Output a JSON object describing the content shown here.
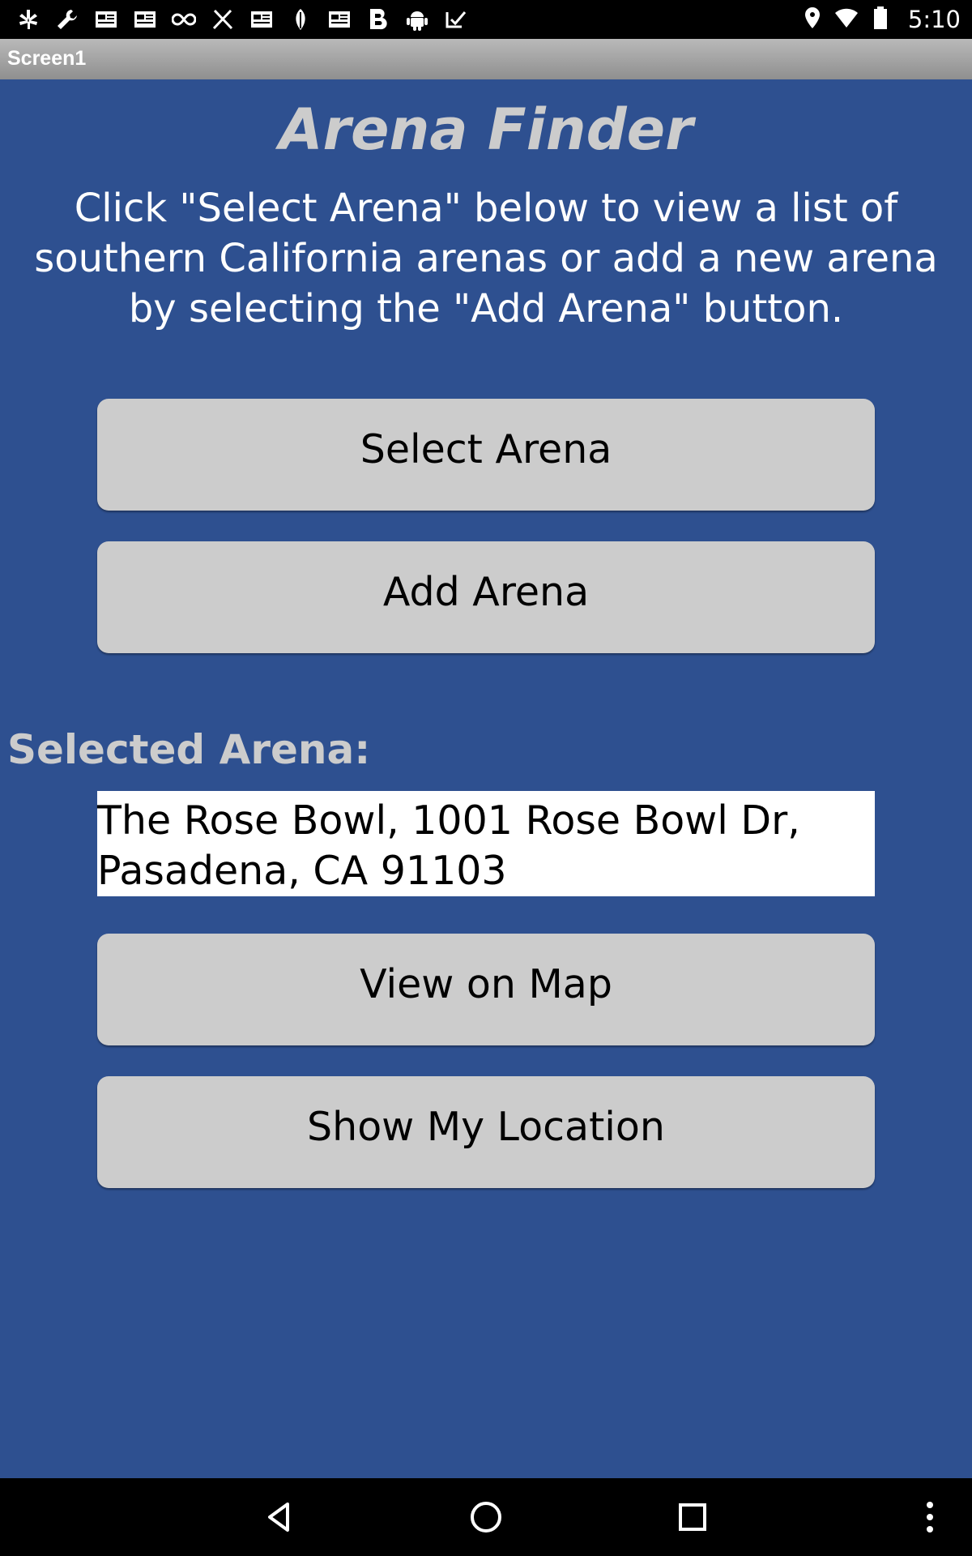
{
  "status_bar": {
    "time": "5:10",
    "left_icons": [
      "yelp-icon",
      "wrench-icon",
      "news-icon",
      "news-icon",
      "infinity-icon",
      "cutlery-icon",
      "news-icon",
      "leaf-icon",
      "news-icon",
      "b-icon",
      "android-icon",
      "check-icon"
    ],
    "right_icons": [
      "location-pin-icon",
      "wifi-icon",
      "battery-icon"
    ]
  },
  "title_bar": {
    "title": "Screen1"
  },
  "main": {
    "app_title": "Arena Finder",
    "instructions": "Click \"Select Arena\" below to view a list of southern California arenas or add a new arena by selecting the \"Add Arena\" button.",
    "select_arena_label": "Select Arena",
    "add_arena_label": "Add Arena",
    "selected_arena_label": "Selected Arena:",
    "selected_arena_value": "The Rose Bowl, 1001 Rose Bowl Dr, Pasadena, CA 91103",
    "view_on_map_label": "View on Map",
    "show_my_location_label": "Show My Location"
  },
  "nav_bar": {
    "buttons": [
      "back-icon",
      "home-icon",
      "recents-icon",
      "menu-icon"
    ]
  },
  "colors": {
    "background": "#2e5090",
    "button": "#cccccc",
    "title_text": "#cccccc"
  }
}
